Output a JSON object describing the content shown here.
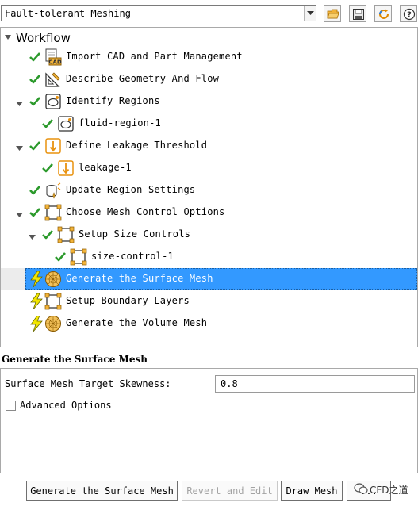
{
  "toolbar": {
    "workflow_select": "Fault-tolerant Meshing",
    "buttons": [
      "open-folder-icon",
      "save-icon",
      "refresh-icon",
      "help-icon"
    ]
  },
  "tree": {
    "root_label": "Workflow",
    "items": [
      {
        "label": "Import CAD and Part Management",
        "status": "done",
        "icon": "cad-import-icon"
      },
      {
        "label": "Describe Geometry And Flow",
        "status": "done",
        "icon": "geometry-ruler-icon"
      },
      {
        "label": "Identify Regions",
        "status": "done",
        "icon": "region-icon"
      },
      {
        "label": "fluid-region-1",
        "status": "done",
        "icon": "region-icon"
      },
      {
        "label": "Define Leakage Threshold",
        "status": "done",
        "icon": "leakage-icon"
      },
      {
        "label": "leakage-1",
        "status": "done",
        "icon": "leakage-icon"
      },
      {
        "label": "Update Region Settings",
        "status": "done",
        "icon": "region-settings-icon"
      },
      {
        "label": "Choose Mesh Control Options",
        "status": "done",
        "icon": "mesh-control-icon"
      },
      {
        "label": "Setup Size Controls",
        "status": "done",
        "icon": "mesh-control-icon"
      },
      {
        "label": "size-control-1",
        "status": "done",
        "icon": "mesh-control-icon"
      },
      {
        "label": "Generate the Surface Mesh",
        "status": "pending",
        "icon": "surface-mesh-icon",
        "selected": true
      },
      {
        "label": "Setup Boundary Layers",
        "status": "pending",
        "icon": "boundary-layer-icon"
      },
      {
        "label": "Generate the Volume Mesh",
        "status": "pending",
        "icon": "volume-mesh-icon"
      }
    ]
  },
  "task_panel": {
    "title": "Generate the Surface Mesh",
    "skewness_label": "Surface Mesh Target Skewness:",
    "skewness_value": "0.8",
    "advanced_label": "Advanced Options",
    "advanced_checked": false
  },
  "buttons": {
    "generate": "Generate the Surface Mesh",
    "revert": "Revert and Edit",
    "draw": "Draw Mesh",
    "more": "..."
  },
  "watermark": "CFD之道",
  "colors": {
    "selection": "#3399ff",
    "check": "#2c9a2c",
    "lightning": "#f2e600",
    "icon_orange": "#e8920f"
  }
}
